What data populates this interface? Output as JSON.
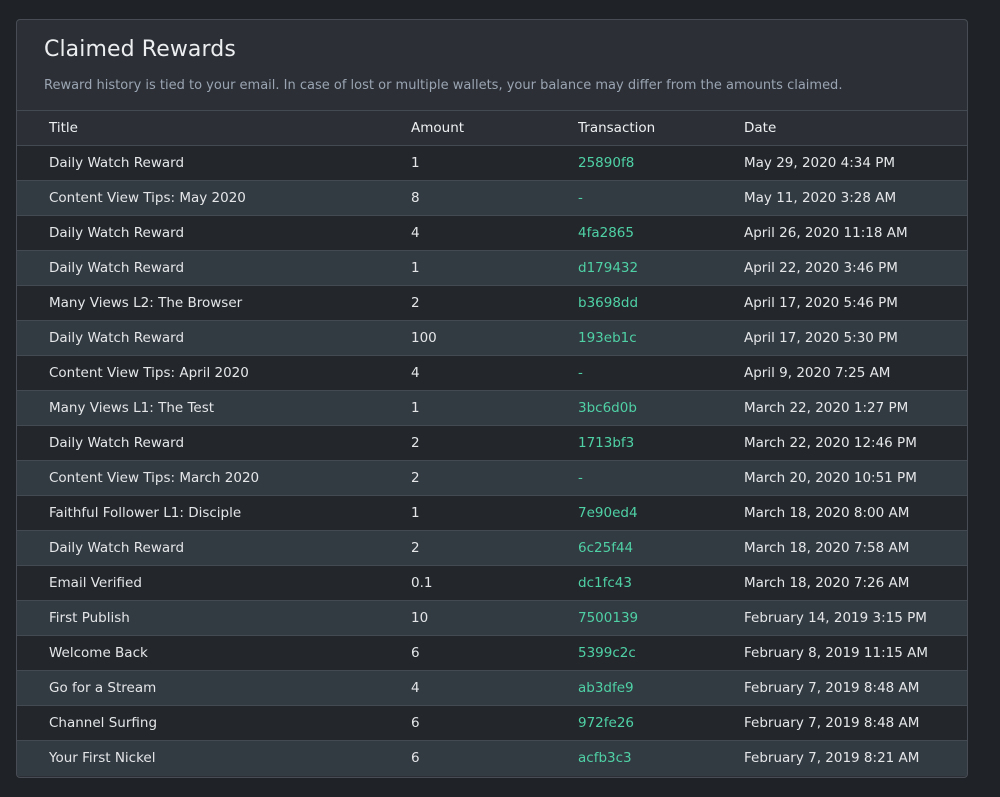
{
  "header": {
    "title": "Claimed Rewards",
    "subtitle": "Reward history is tied to your email. In case of lost or multiple wallets, your balance may differ from the amounts claimed."
  },
  "table": {
    "columns": [
      "Title",
      "Amount",
      "Transaction",
      "Date"
    ],
    "rows": [
      {
        "title": "Daily Watch Reward",
        "amount": "1",
        "transaction": "25890f8",
        "date": "May 29, 2020 4:34 PM"
      },
      {
        "title": "Content View Tips: May 2020",
        "amount": "8",
        "transaction": "-",
        "date": "May 11, 2020 3:28 AM"
      },
      {
        "title": "Daily Watch Reward",
        "amount": "4",
        "transaction": "4fa2865",
        "date": "April 26, 2020 11:18 AM"
      },
      {
        "title": "Daily Watch Reward",
        "amount": "1",
        "transaction": "d179432",
        "date": "April 22, 2020 3:46 PM"
      },
      {
        "title": "Many Views L2: The Browser",
        "amount": "2",
        "transaction": "b3698dd",
        "date": "April 17, 2020 5:46 PM"
      },
      {
        "title": "Daily Watch Reward",
        "amount": "100",
        "transaction": "193eb1c",
        "date": "April 17, 2020 5:30 PM"
      },
      {
        "title": "Content View Tips: April 2020",
        "amount": "4",
        "transaction": "-",
        "date": "April 9, 2020 7:25 AM"
      },
      {
        "title": "Many Views L1: The Test",
        "amount": "1",
        "transaction": "3bc6d0b",
        "date": "March 22, 2020 1:27 PM"
      },
      {
        "title": "Daily Watch Reward",
        "amount": "2",
        "transaction": "1713bf3",
        "date": "March 22, 2020 12:46 PM"
      },
      {
        "title": "Content View Tips: March 2020",
        "amount": "2",
        "transaction": "-",
        "date": "March 20, 2020 10:51 PM"
      },
      {
        "title": "Faithful Follower L1: Disciple",
        "amount": "1",
        "transaction": "7e90ed4",
        "date": "March 18, 2020 8:00 AM"
      },
      {
        "title": "Daily Watch Reward",
        "amount": "2",
        "transaction": "6c25f44",
        "date": "March 18, 2020 7:58 AM"
      },
      {
        "title": "Email Verified",
        "amount": "0.1",
        "transaction": "dc1fc43",
        "date": "March 18, 2020 7:26 AM"
      },
      {
        "title": "First Publish",
        "amount": "10",
        "transaction": "7500139",
        "date": "February 14, 2019 3:15 PM"
      },
      {
        "title": "Welcome Back",
        "amount": "6",
        "transaction": "5399c2c",
        "date": "February 8, 2019 11:15 AM"
      },
      {
        "title": "Go for a Stream",
        "amount": "4",
        "transaction": "ab3dfe9",
        "date": "February 7, 2019 8:48 AM"
      },
      {
        "title": "Channel Surfing",
        "amount": "6",
        "transaction": "972fe26",
        "date": "February 7, 2019 8:48 AM"
      },
      {
        "title": "Your First Nickel",
        "amount": "6",
        "transaction": "acfb3c3",
        "date": "February 7, 2019 8:21 AM"
      }
    ]
  },
  "colors": {
    "page_background": "#1f2226",
    "card_background": "#2c3036",
    "row_alt": "#323a42",
    "transaction_link": "#4fd1a5",
    "subtitle_text": "#9aa4b2"
  }
}
